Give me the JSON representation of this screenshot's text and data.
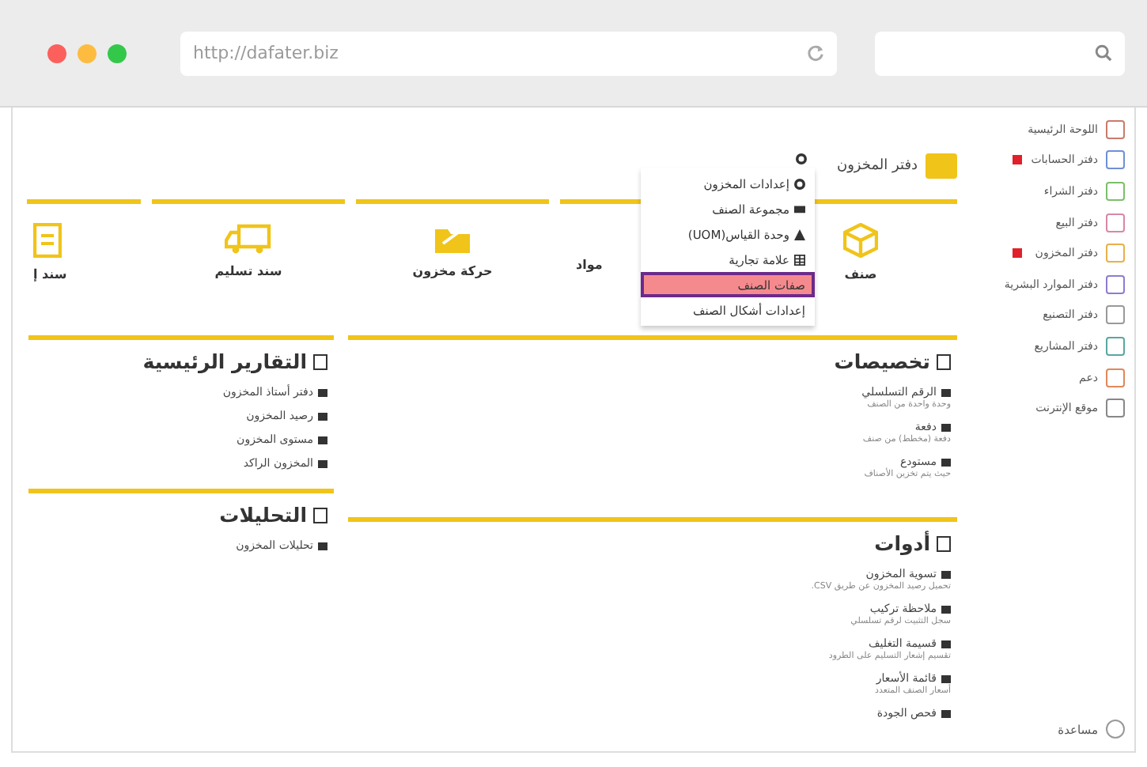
{
  "browser": {
    "url": "http://dafater.biz"
  },
  "header": {
    "title": "دفتر المخزون"
  },
  "menu": [
    {
      "label": "إعدادات المخزون",
      "selected": false
    },
    {
      "label": "مجموعة الصنف",
      "selected": false
    },
    {
      "label": "وحدة القياس(UOM)",
      "selected": false
    },
    {
      "label": "علامة تجارية",
      "selected": false
    },
    {
      "label": "صفات الصنف",
      "selected": true
    },
    {
      "label": "إعدادات أشكال الصنف",
      "selected": false
    }
  ],
  "cards": [
    {
      "label": "صنف"
    },
    {
      "label": "مواد"
    },
    {
      "label": "حركة مخزون"
    },
    {
      "label": "سند تسليم"
    },
    {
      "label": "سند إ"
    }
  ],
  "right_column": [
    {
      "title": "تخصيصات",
      "items": [
        {
          "label": "الرقم التسلسلي",
          "description": "وحدة واحدة من الصنف"
        },
        {
          "label": "دفعة",
          "description": "دفعة (مخطط) من صنف"
        },
        {
          "label": "مستودع",
          "description": "حيث يتم تخزين الأصناف"
        }
      ]
    },
    {
      "title": "أدوات",
      "items": [
        {
          "label": "تسوية المخزون",
          "description": "تحميل رصيد المخزون عن طريق CSV."
        },
        {
          "label": "ملاحظة تركيب",
          "description": "سجل التثبيت لرقم تسلسلي"
        },
        {
          "label": "قسيمة التغليف",
          "description": "تقسيم إشعار التسليم على الطرود"
        },
        {
          "label": "قائمة الأسعار",
          "description": "أسعار الصنف المتعدد"
        },
        {
          "label": "فحص الجودة"
        }
      ]
    }
  ],
  "left_column": [
    {
      "title": "التقارير الرئيسية",
      "items": [
        {
          "label": "دفتر أستاذ المخزون"
        },
        {
          "label": "رصيد المخزون"
        },
        {
          "label": "مستوى المخزون"
        },
        {
          "label": "المخزون الراكد"
        }
      ]
    },
    {
      "title": "التحليلات",
      "items": [
        {
          "label": "تحليلات المخزون"
        }
      ]
    }
  ],
  "sidebar": {
    "items": [
      {
        "label": "اللوحة الرئيسية",
        "alert": false
      },
      {
        "label": "دفتر الحسابات",
        "alert": true
      },
      {
        "label": "دفتر الشراء",
        "alert": false
      },
      {
        "label": "دفتر البيع",
        "alert": false
      },
      {
        "label": "دفتر المخزون",
        "alert": true
      },
      {
        "label": "دفتر الموارد البشرية",
        "alert": false
      },
      {
        "label": "دفتر التصنيع",
        "alert": false
      },
      {
        "label": "دفتر المشاريع",
        "alert": false
      },
      {
        "label": "دعم",
        "alert": false
      },
      {
        "label": "موقع الإنترنت",
        "alert": false
      }
    ],
    "help": "مساعدة"
  }
}
